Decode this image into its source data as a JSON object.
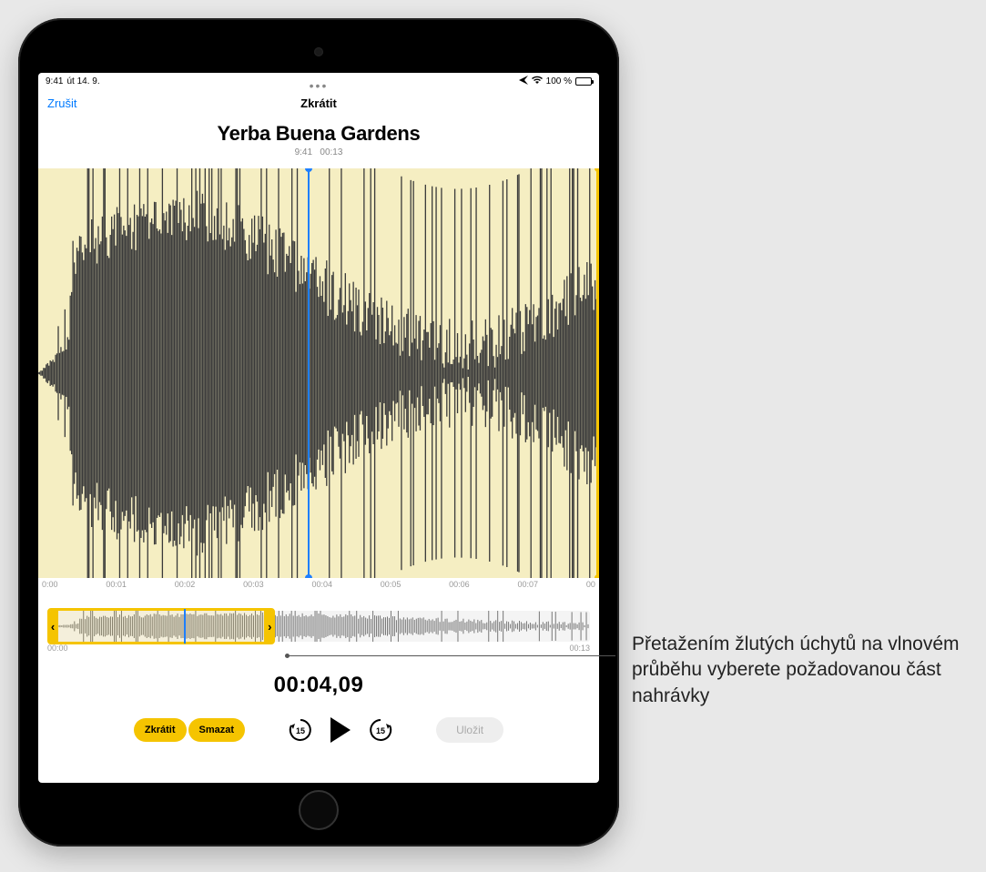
{
  "status": {
    "time": "9:41",
    "date": "út 14. 9.",
    "battery_pct": "100 %"
  },
  "nav": {
    "cancel": "Zrušit",
    "title": "Zkrátit",
    "more": "•••"
  },
  "recording": {
    "title": "Yerba Buena Gardens",
    "meta_time": "9:41",
    "meta_dur": "00:13"
  },
  "ruler": {
    "t0": "0:00",
    "t1": "00:01",
    "t2": "00:02",
    "t3": "00:03",
    "t4": "00:04",
    "t5": "00:05",
    "t6": "00:06",
    "t7": "00:07",
    "t8": "00"
  },
  "overview_ruler": {
    "start": "00:00",
    "end": "00:13"
  },
  "timecode": "00:04,09",
  "controls": {
    "trim": "Zkrátit",
    "delete": "Smazat",
    "skip": "15",
    "save": "Uložit"
  },
  "callout": "Přetažením žlutých úchytů na vlnovém průběhu vyberete požadovanou část nahrávky"
}
